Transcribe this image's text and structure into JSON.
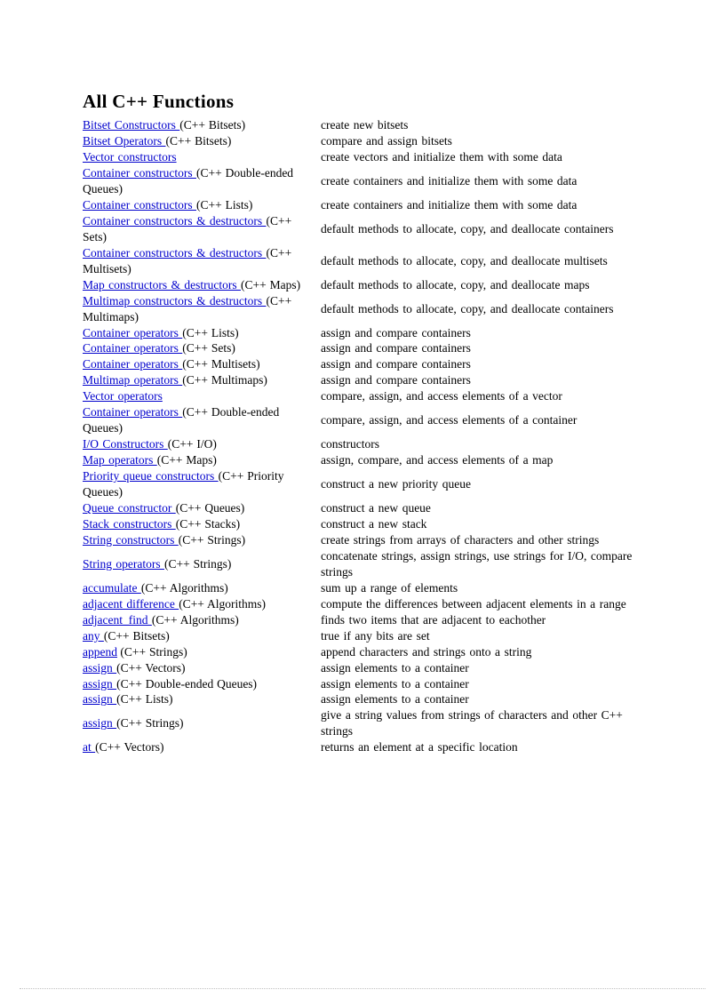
{
  "page": {
    "title": "All C++ Functions",
    "background_color": "#ffffff",
    "link_color": "#0000cc",
    "text_color": "#000000",
    "rule_color": "#bfbfbf"
  },
  "rows": [
    {
      "link": "Bitset Constructors ",
      "suffix": "(C++ Bitsets)",
      "desc": "create new bitsets"
    },
    {
      "link": "Bitset Operators ",
      "suffix": "(C++ Bitsets)",
      "desc": "compare and assign bitsets"
    },
    {
      "link": "Vector constructors ",
      "suffix": "",
      "desc": "create vectors and initialize  them with some data"
    },
    {
      "link": "Container constructors ",
      "suffix": "(C++ Double-ended Queues)",
      "desc": "create containers and initialize  them with some data"
    },
    {
      "link": "Container constructors ",
      "suffix": "(C++ Lists)",
      "desc": "create containers and initialize  them with some data"
    },
    {
      "link": "Container constructors  & destructors ",
      "suffix": "(C++ Sets)",
      "desc": "default methods to allocate, copy, and deallocate containers"
    },
    {
      "link": "Container constructors  & destructors ",
      "suffix": "(C++ Multisets)",
      "desc": "default methods to allocate, copy, and deallocate multisets"
    },
    {
      "link": "Map constructors  & destructors ",
      "suffix": "(C++ Maps)",
      "desc": "default methods to allocate, copy, and deallocate maps"
    },
    {
      "link": "Multimap constructors & destructors ",
      "suffix": "(C++ Multimaps)",
      "desc": "default methods to allocate, copy, and deallocate containers"
    },
    {
      "link": "Container operators ",
      "suffix": "(C++ Lists)",
      "desc": "assign and compare containers"
    },
    {
      "link": "Container operators ",
      "suffix": "(C++ Sets)",
      "desc": "assign and compare containers"
    },
    {
      "link": "Container operators ",
      "suffix": "(C++ Multisets)",
      "desc": "assign and compare containers"
    },
    {
      "link": "Multimap operators ",
      "suffix": "(C++ Multimaps)",
      "desc": "assign and compare containers"
    },
    {
      "link": "Vector operators ",
      "suffix": "",
      "desc": "compare, assign, and access elements of a vector"
    },
    {
      "link": "Container operators ",
      "suffix": "(C++ Double-ended Queues)",
      "desc": "compare, assign, and access elements of a container"
    },
    {
      "link": "I/O Constructors ",
      "suffix": "(C++ I/O)",
      "desc": "constructors"
    },
    {
      "link": "Map operators ",
      "suffix": "(C++ Maps)",
      "desc": "assign, compare, and access elements of a map"
    },
    {
      "link": "Priority queue constructors ",
      "suffix": "(C++ Priority Queues)",
      "desc": "construct a new priority queue"
    },
    {
      "link": "Queue constructor ",
      "suffix": "(C++ Queues)",
      "desc": "construct a new queue"
    },
    {
      "link": "Stack constructors ",
      "suffix": "(C++ Stacks)",
      "desc": "construct a new stack"
    },
    {
      "link": "String constructors ",
      "suffix": "(C++ Strings)",
      "desc": "create strings from arrays of characters and other strings"
    },
    {
      "link": "String operators ",
      "suffix": "(C++ Strings)",
      "desc": "concatenate strings, assign strings, use strings for I/O, compare strings"
    },
    {
      "link": "accumulate ",
      "suffix": "(C++ Algorithms)",
      "desc": "sum up a range of elements"
    },
    {
      "link": "adjacent difference ",
      "suffix": "(C++ Algorithms)",
      "desc": "compute the differences  between adjacent elements in a range"
    },
    {
      "link": "adjacent_find ",
      "suffix": "(C++ Algorithms)",
      "desc": "finds two items that are adjacent to eachother"
    },
    {
      "link": "any ",
      "suffix": "(C++ Bitsets)",
      "desc": "true if any bits are set"
    },
    {
      "link": "append",
      "suffix": "(C++ Strings)",
      "desc": "append characters and strings onto a string"
    },
    {
      "link": "assign ",
      "suffix": "(C++ Vectors)",
      "desc": "assign elements to a container"
    },
    {
      "link": "assign ",
      "suffix": "(C++ Double-ended Queues)",
      "desc": "assign elements to a container"
    },
    {
      "link": "assign ",
      "suffix": "(C++ Lists)",
      "desc": "assign elements to a container"
    },
    {
      "link": "assign ",
      "suffix": "(C++ Strings)",
      "desc": "give a string values from strings of characters and other C++ strings"
    },
    {
      "link": "at ",
      "suffix": "(C++ Vectors)",
      "desc": "returns an element at a specific location"
    }
  ]
}
